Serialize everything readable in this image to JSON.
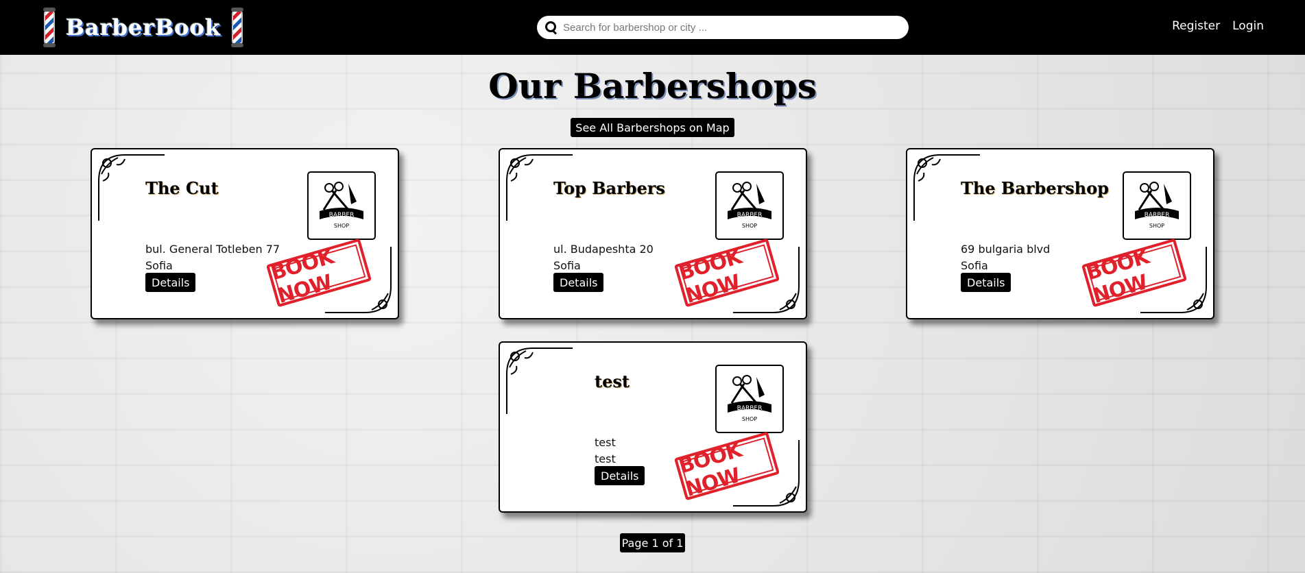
{
  "header": {
    "brand": "BarberBook",
    "search_placeholder": "Search for barbershop or city ...",
    "nav": {
      "register": "Register",
      "login": "Login"
    }
  },
  "main": {
    "title": "Our Barbershops",
    "map_button": "See All Barbershops on Map",
    "shops": [
      {
        "name": "The Cut",
        "address": "bul. General Totleben 77",
        "city": "Sofia",
        "details_label": "Details",
        "badge": "BOOK NOW"
      },
      {
        "name": "Top Barbers",
        "address": "ul. Budapeshta 20",
        "city": "Sofia",
        "details_label": "Details",
        "badge": "BOOK NOW"
      },
      {
        "name": "The Barbershop",
        "address": "69 bulgaria blvd",
        "city": "Sofia",
        "details_label": "Details",
        "badge": "BOOK NOW"
      },
      {
        "name": "test",
        "address": "test",
        "city": "test",
        "details_label": "Details",
        "badge": "BOOK NOW"
      }
    ],
    "pagination": "Page 1 of 1"
  },
  "colors": {
    "header_bg": "#000000",
    "badge_red": "#e0202a",
    "button_bg": "#000000"
  },
  "logo": {
    "lines": [
      "BARBER",
      "SHOP"
    ]
  }
}
